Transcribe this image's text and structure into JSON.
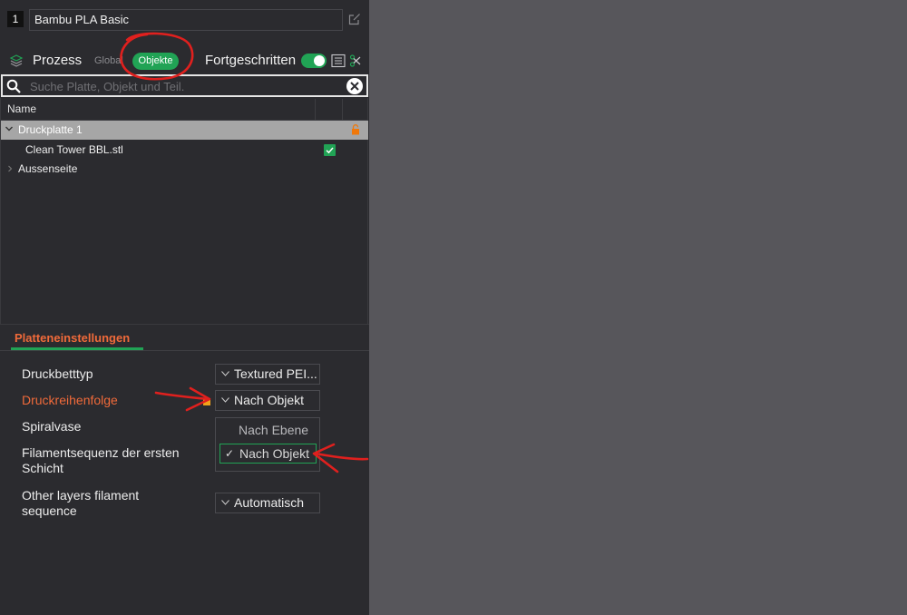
{
  "filament": {
    "number": "1",
    "name": "Bambu PLA Basic"
  },
  "process": {
    "title": "Prozess",
    "tab_global": "Global",
    "tab_objects": "Objekte",
    "advanced_label": "Fortgeschritten",
    "advanced_enabled": true
  },
  "search": {
    "placeholder": "Suche Platte, Objekt und Teil."
  },
  "object_list": {
    "header_name": "Name",
    "plate": "Druckplatte 1",
    "object": "Clean Tower BBL.stl",
    "outer": "Aussenseite"
  },
  "plate_settings": {
    "tab_label": "Platteneinstellungen",
    "rows": [
      {
        "label": "Druckbetttyp",
        "value": "Textured PEI..."
      },
      {
        "label": "Druckreihenfolge",
        "value": "Nach Objekt"
      },
      {
        "label": "Spiralvase"
      },
      {
        "label_line1": "Filamentsequenz der ersten",
        "label_line2": "Schicht"
      },
      {
        "label_line1": "Other layers filament",
        "label_line2": "sequence",
        "value": "Automatisch"
      }
    ],
    "dropdown_options": [
      "Nach Ebene",
      "Nach Objekt"
    ],
    "dropdown_selected": "Nach Objekt"
  },
  "colors": {
    "accent": "#21a355",
    "modified": "#f06a3a",
    "annotation": "#e0201e",
    "background": "#2b2b2f"
  }
}
